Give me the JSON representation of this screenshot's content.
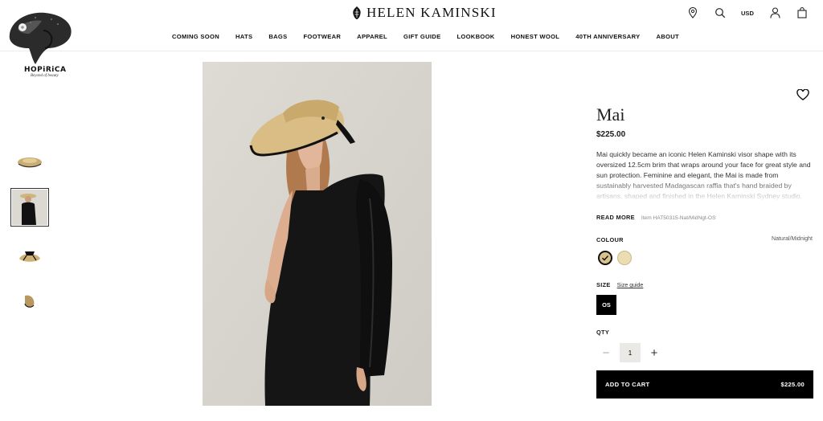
{
  "brand": {
    "name": "HELEN KAMINSKI"
  },
  "nav": [
    "COMING SOON",
    "HATS",
    "BAGS",
    "FOOTWEAR",
    "APPAREL",
    "GIFT GUIDE",
    "LOOKBOOK",
    "HONEST WOOL",
    "40TH ANNIVERSARY",
    "ABOUT"
  ],
  "header": {
    "currency": "USD"
  },
  "overlay_logo": {
    "name": "HOPiRiCA",
    "tagline": "Beyond of beauty"
  },
  "product": {
    "title": "Mai",
    "price": "$225.00",
    "description": "Mai quickly became an iconic Helen Kaminski visor shape with its oversized 12.5cm brim that wraps around your face for great style and sun protection. Feminine and elegant, the Mai is made from sustainably harvested Madagascan raffia that's hand braided by artisans, shaped and finished in the Helen Kaminski Sydney studio.",
    "read_more": "READ MORE",
    "item_code": "Item HAT50315-Nat/MidNgt-OS",
    "colour_label": "COLOUR",
    "colour_value": "Natural/Midnight",
    "size_label": "SIZE",
    "size_guide": "Size guide",
    "size_option": "OS",
    "qty_label": "QTY",
    "qty_value": "1",
    "cart_label": "ADD TO CART",
    "cart_price": "$225.00"
  },
  "colors": {
    "accent": "#000000",
    "swatch_natural": "#d8c38c",
    "swatch_light": "#ecdcb2",
    "image_bg": "#d9d6d1"
  }
}
